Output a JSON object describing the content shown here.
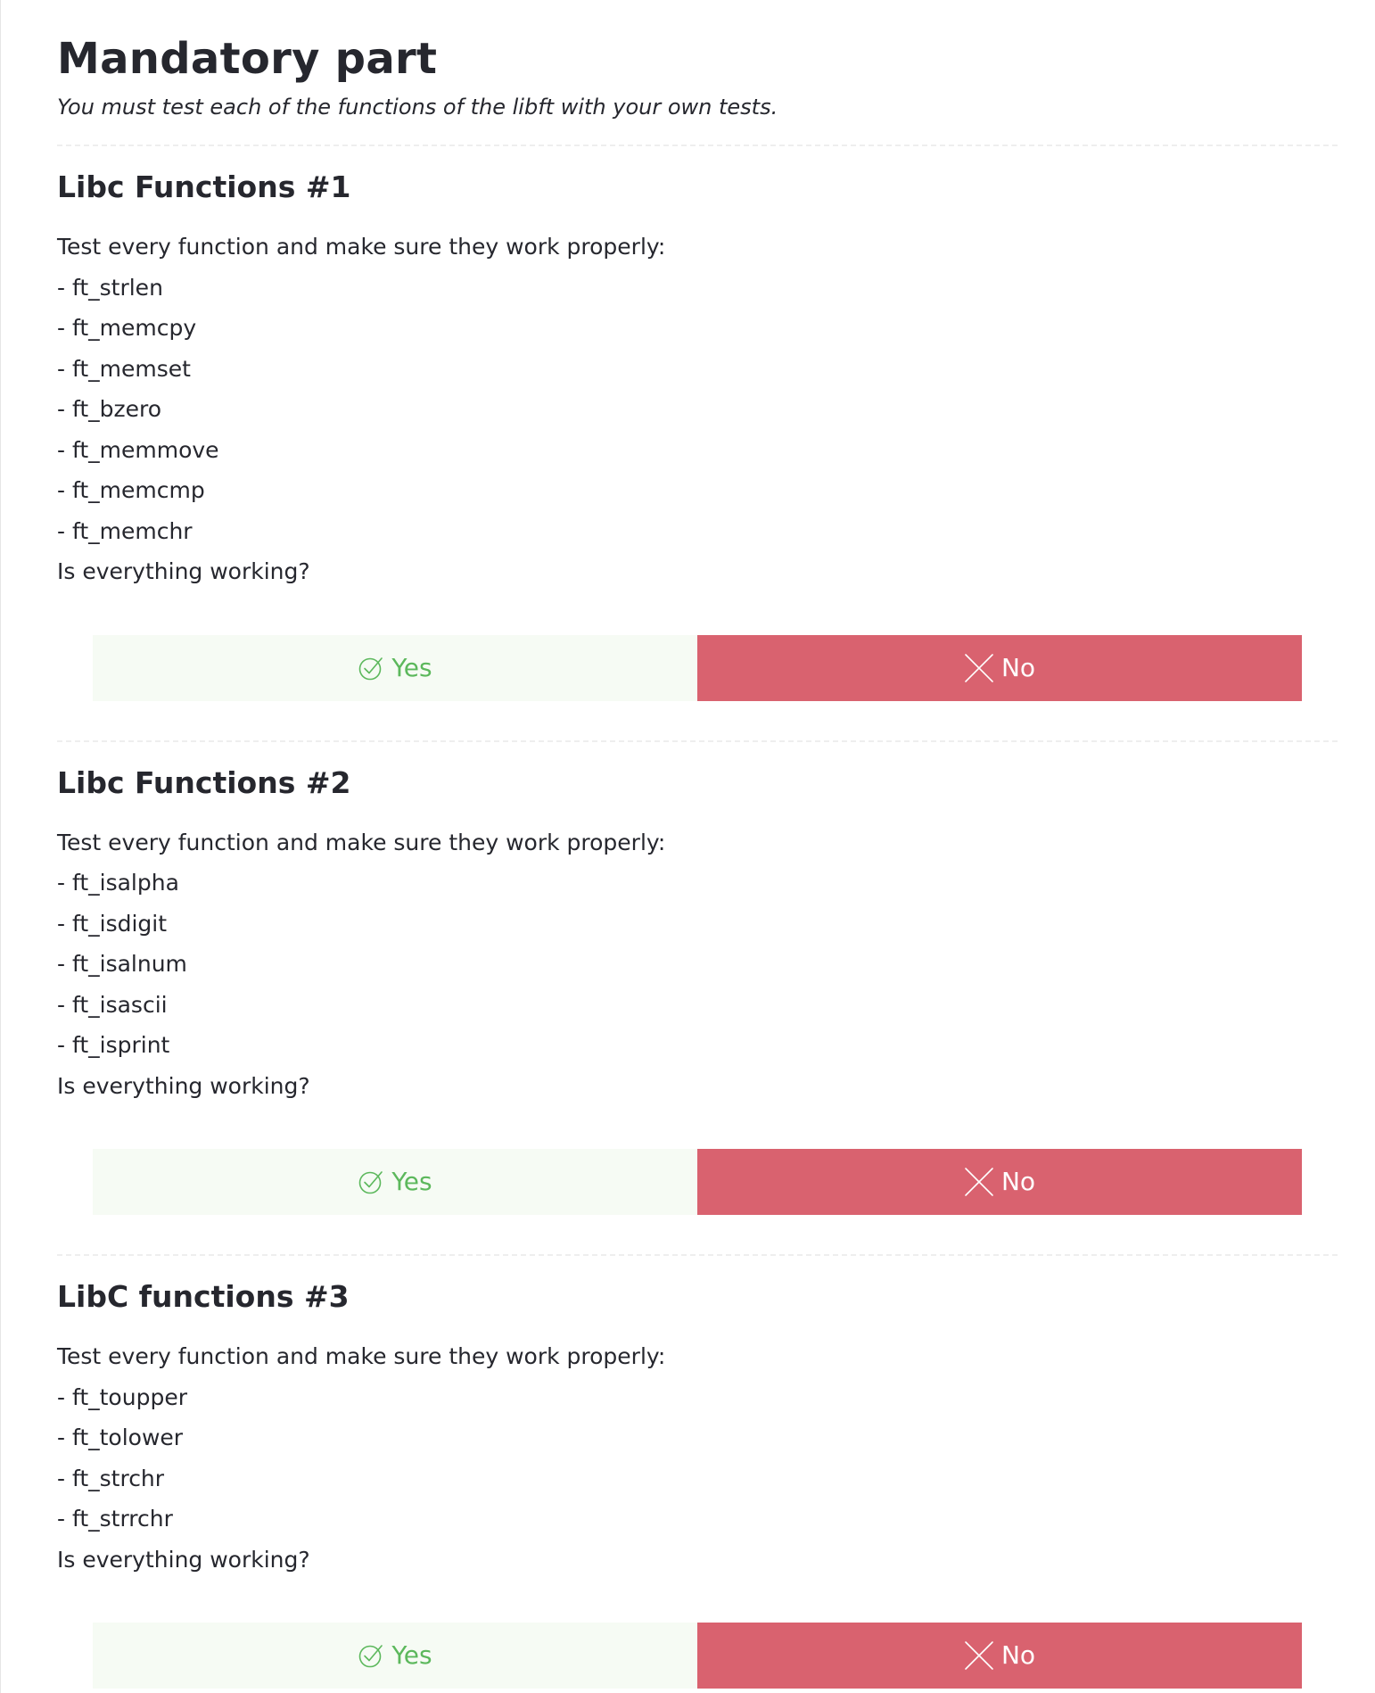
{
  "header": {
    "title": "Mandatory part",
    "subtitle": "You must test each of the functions of the libft with your own tests."
  },
  "sections": [
    {
      "title": "Libc Functions #1",
      "intro": "Test every function and make sure they work properly:",
      "items": [
        "- ft_strlen",
        "- ft_memcpy",
        "- ft_memset",
        "- ft_bzero",
        "- ft_memmove",
        "- ft_memcmp",
        "- ft_memchr"
      ],
      "question": "Is everything working?",
      "yes_label": "Yes",
      "no_label": "No"
    },
    {
      "title": "Libc Functions #2",
      "intro": "Test every function and make sure they work properly:",
      "items": [
        "- ft_isalpha",
        "- ft_isdigit",
        "- ft_isalnum",
        "- ft_isascii",
        "- ft_isprint"
      ],
      "question": "Is everything working?",
      "yes_label": "Yes",
      "no_label": "No"
    },
    {
      "title": "LibC functions #3",
      "intro": "Test every function and make sure they work properly:",
      "items": [
        "- ft_toupper",
        "- ft_tolower",
        "- ft_strchr",
        "- ft_strrchr"
      ],
      "question": "Is everything working?",
      "yes_label": "Yes",
      "no_label": "No"
    }
  ],
  "colors": {
    "yes_bg": "#f6fbf4",
    "yes_text": "#5cb85c",
    "no_bg": "#d9626f",
    "no_text": "#ffffff",
    "text": "#26272e"
  },
  "icons": {
    "yes": "check-circle-icon",
    "no": "cross-icon"
  }
}
